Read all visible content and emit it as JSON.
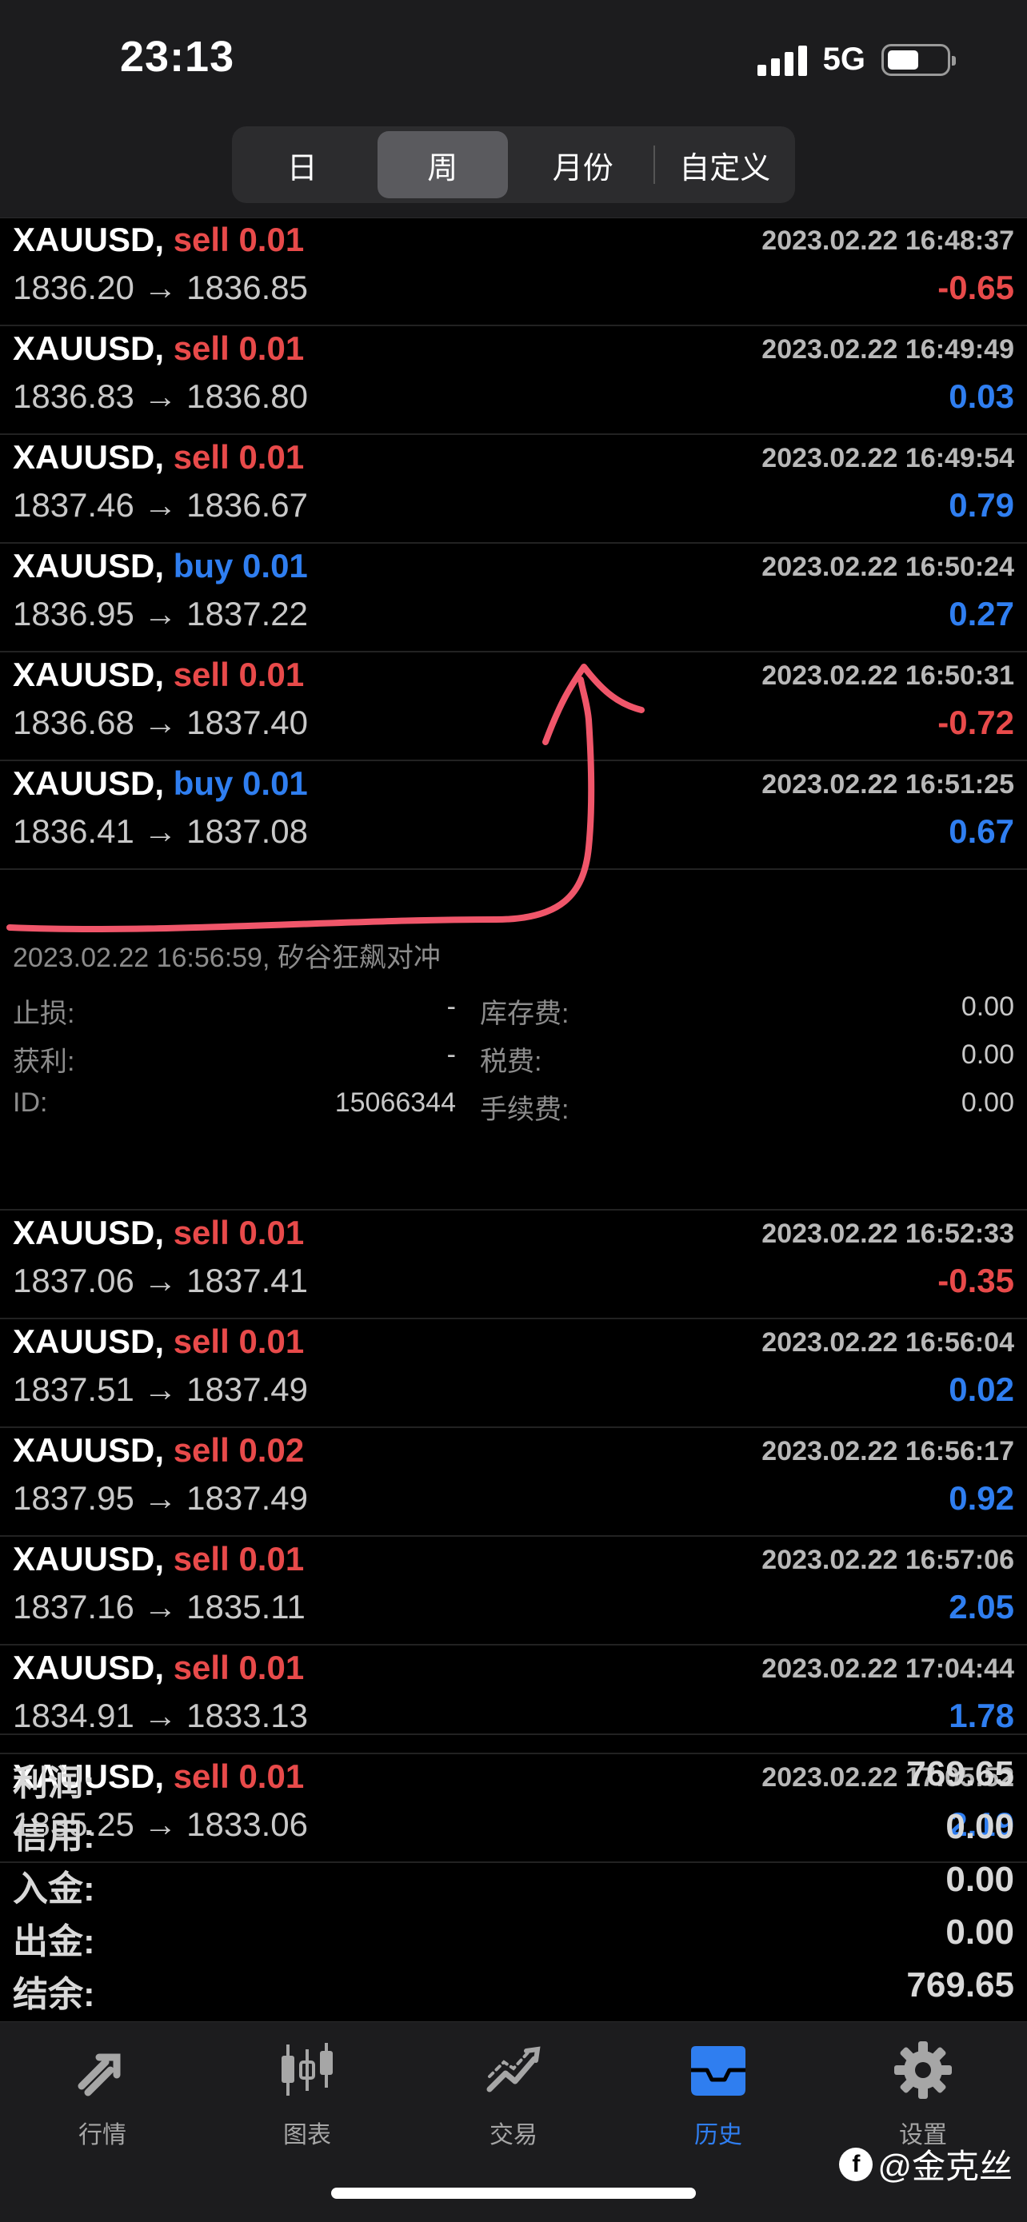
{
  "status": {
    "time": "23:13",
    "network": "5G"
  },
  "period_tabs": [
    {
      "label": "日",
      "active": false
    },
    {
      "label": "周",
      "active": true
    },
    {
      "label": "月份",
      "active": false
    },
    {
      "label": "自定义",
      "active": false
    }
  ],
  "trades": [
    {
      "symbol": "XAUUSD,",
      "dir": "sell",
      "lots": "0.01",
      "time": "2023.02.22 16:48:37",
      "prices": "1836.20 → 1836.85",
      "profit": "-0.65"
    },
    {
      "symbol": "XAUUSD,",
      "dir": "sell",
      "lots": "0.01",
      "time": "2023.02.22 16:49:49",
      "prices": "1836.83 → 1836.80",
      "profit": "0.03"
    },
    {
      "symbol": "XAUUSD,",
      "dir": "sell",
      "lots": "0.01",
      "time": "2023.02.22 16:49:54",
      "prices": "1837.46 → 1836.67",
      "profit": "0.79"
    },
    {
      "symbol": "XAUUSD,",
      "dir": "buy",
      "lots": "0.01",
      "time": "2023.02.22 16:50:24",
      "prices": "1836.95 → 1837.22",
      "profit": "0.27"
    },
    {
      "symbol": "XAUUSD,",
      "dir": "sell",
      "lots": "0.01",
      "time": "2023.02.22 16:50:31",
      "prices": "1836.68 → 1837.40",
      "profit": "-0.72"
    },
    {
      "symbol": "XAUUSD,",
      "dir": "buy",
      "lots": "0.01",
      "time": "2023.02.22 16:51:25",
      "prices": "1836.41 → 1837.08",
      "profit": "0.67"
    }
  ],
  "expanded_detail": {
    "comment": "2023.02.22 16:56:59, 矽谷狂飙对冲",
    "sl_label": "止损:",
    "sl_value": "-",
    "tp_label": "获利:",
    "tp_value": "-",
    "id_label": "ID:",
    "id_value": "15066344",
    "swap_label": "库存费:",
    "swap_value": "0.00",
    "tax_label": "税费:",
    "tax_value": "0.00",
    "fee_label": "手续费:",
    "fee_value": "0.00"
  },
  "trades_after": [
    {
      "symbol": "XAUUSD,",
      "dir": "sell",
      "lots": "0.01",
      "time": "2023.02.22 16:52:33",
      "prices": "1837.06 → 1837.41",
      "profit": "-0.35"
    },
    {
      "symbol": "XAUUSD,",
      "dir": "sell",
      "lots": "0.01",
      "time": "2023.02.22 16:56:04",
      "prices": "1837.51 → 1837.49",
      "profit": "0.02"
    },
    {
      "symbol": "XAUUSD,",
      "dir": "sell",
      "lots": "0.02",
      "time": "2023.02.22 16:56:17",
      "prices": "1837.95 → 1837.49",
      "profit": "0.92"
    },
    {
      "symbol": "XAUUSD,",
      "dir": "sell",
      "lots": "0.01",
      "time": "2023.02.22 16:57:06",
      "prices": "1837.16 → 1835.11",
      "profit": "2.05"
    },
    {
      "symbol": "XAUUSD,",
      "dir": "sell",
      "lots": "0.01",
      "time": "2023.02.22 17:04:44",
      "prices": "1834.91 → 1833.13",
      "profit": "1.78"
    },
    {
      "symbol": "XAUUSD,",
      "dir": "sell",
      "lots": "0.01",
      "time": "2023.02.22 17:05:52",
      "prices": "1835.25 → 1833.06",
      "profit": "2.19"
    }
  ],
  "totals": [
    {
      "label": "利润:",
      "value": "769.65"
    },
    {
      "label": "信用:",
      "value": "0.00"
    },
    {
      "label": "入金:",
      "value": "0.00"
    },
    {
      "label": "出金:",
      "value": "0.00"
    },
    {
      "label": "结余:",
      "value": "769.65"
    }
  ],
  "tabbar": [
    {
      "label": "行情",
      "icon": "quotes-arrows-icon",
      "active": false
    },
    {
      "label": "图表",
      "icon": "candlestick-chart-icon",
      "active": false
    },
    {
      "label": "交易",
      "icon": "trade-line-chart-icon",
      "active": false
    },
    {
      "label": "历史",
      "icon": "inbox-tray-icon",
      "active": true
    },
    {
      "label": "设置",
      "icon": "gear-icon",
      "active": false
    }
  ],
  "watermark": "@金克丝",
  "colors": {
    "sell": "#e84a4a",
    "buy": "#2f7ef0",
    "annotation": "#f0566a"
  }
}
